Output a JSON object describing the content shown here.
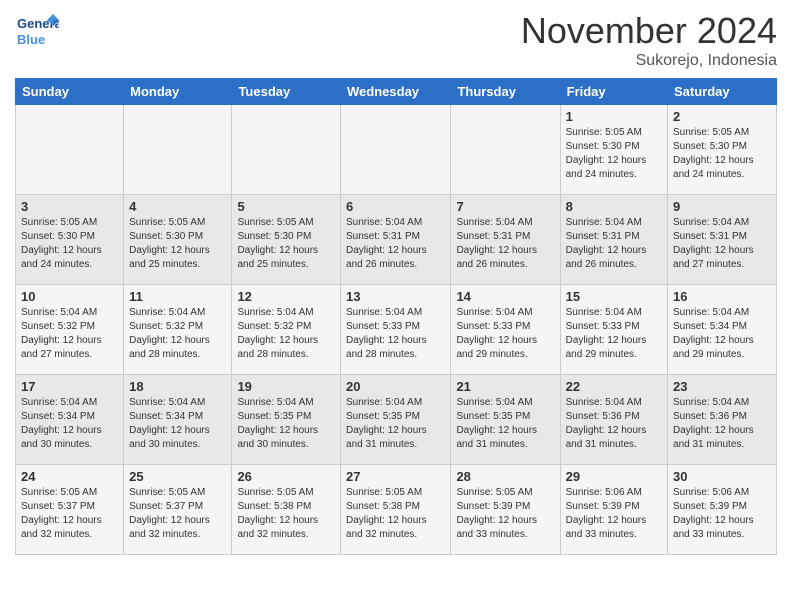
{
  "logo": {
    "general": "General",
    "blue": "Blue"
  },
  "header": {
    "month": "November 2024",
    "location": "Sukorejo, Indonesia"
  },
  "weekdays": [
    "Sunday",
    "Monday",
    "Tuesday",
    "Wednesday",
    "Thursday",
    "Friday",
    "Saturday"
  ],
  "weeks": [
    [
      {
        "day": "",
        "info": ""
      },
      {
        "day": "",
        "info": ""
      },
      {
        "day": "",
        "info": ""
      },
      {
        "day": "",
        "info": ""
      },
      {
        "day": "",
        "info": ""
      },
      {
        "day": "1",
        "info": "Sunrise: 5:05 AM\nSunset: 5:30 PM\nDaylight: 12 hours\nand 24 minutes."
      },
      {
        "day": "2",
        "info": "Sunrise: 5:05 AM\nSunset: 5:30 PM\nDaylight: 12 hours\nand 24 minutes."
      }
    ],
    [
      {
        "day": "3",
        "info": "Sunrise: 5:05 AM\nSunset: 5:30 PM\nDaylight: 12 hours\nand 24 minutes."
      },
      {
        "day": "4",
        "info": "Sunrise: 5:05 AM\nSunset: 5:30 PM\nDaylight: 12 hours\nand 25 minutes."
      },
      {
        "day": "5",
        "info": "Sunrise: 5:05 AM\nSunset: 5:30 PM\nDaylight: 12 hours\nand 25 minutes."
      },
      {
        "day": "6",
        "info": "Sunrise: 5:04 AM\nSunset: 5:31 PM\nDaylight: 12 hours\nand 26 minutes."
      },
      {
        "day": "7",
        "info": "Sunrise: 5:04 AM\nSunset: 5:31 PM\nDaylight: 12 hours\nand 26 minutes."
      },
      {
        "day": "8",
        "info": "Sunrise: 5:04 AM\nSunset: 5:31 PM\nDaylight: 12 hours\nand 26 minutes."
      },
      {
        "day": "9",
        "info": "Sunrise: 5:04 AM\nSunset: 5:31 PM\nDaylight: 12 hours\nand 27 minutes."
      }
    ],
    [
      {
        "day": "10",
        "info": "Sunrise: 5:04 AM\nSunset: 5:32 PM\nDaylight: 12 hours\nand 27 minutes."
      },
      {
        "day": "11",
        "info": "Sunrise: 5:04 AM\nSunset: 5:32 PM\nDaylight: 12 hours\nand 28 minutes."
      },
      {
        "day": "12",
        "info": "Sunrise: 5:04 AM\nSunset: 5:32 PM\nDaylight: 12 hours\nand 28 minutes."
      },
      {
        "day": "13",
        "info": "Sunrise: 5:04 AM\nSunset: 5:33 PM\nDaylight: 12 hours\nand 28 minutes."
      },
      {
        "day": "14",
        "info": "Sunrise: 5:04 AM\nSunset: 5:33 PM\nDaylight: 12 hours\nand 29 minutes."
      },
      {
        "day": "15",
        "info": "Sunrise: 5:04 AM\nSunset: 5:33 PM\nDaylight: 12 hours\nand 29 minutes."
      },
      {
        "day": "16",
        "info": "Sunrise: 5:04 AM\nSunset: 5:34 PM\nDaylight: 12 hours\nand 29 minutes."
      }
    ],
    [
      {
        "day": "17",
        "info": "Sunrise: 5:04 AM\nSunset: 5:34 PM\nDaylight: 12 hours\nand 30 minutes."
      },
      {
        "day": "18",
        "info": "Sunrise: 5:04 AM\nSunset: 5:34 PM\nDaylight: 12 hours\nand 30 minutes."
      },
      {
        "day": "19",
        "info": "Sunrise: 5:04 AM\nSunset: 5:35 PM\nDaylight: 12 hours\nand 30 minutes."
      },
      {
        "day": "20",
        "info": "Sunrise: 5:04 AM\nSunset: 5:35 PM\nDaylight: 12 hours\nand 31 minutes."
      },
      {
        "day": "21",
        "info": "Sunrise: 5:04 AM\nSunset: 5:35 PM\nDaylight: 12 hours\nand 31 minutes."
      },
      {
        "day": "22",
        "info": "Sunrise: 5:04 AM\nSunset: 5:36 PM\nDaylight: 12 hours\nand 31 minutes."
      },
      {
        "day": "23",
        "info": "Sunrise: 5:04 AM\nSunset: 5:36 PM\nDaylight: 12 hours\nand 31 minutes."
      }
    ],
    [
      {
        "day": "24",
        "info": "Sunrise: 5:05 AM\nSunset: 5:37 PM\nDaylight: 12 hours\nand 32 minutes."
      },
      {
        "day": "25",
        "info": "Sunrise: 5:05 AM\nSunset: 5:37 PM\nDaylight: 12 hours\nand 32 minutes."
      },
      {
        "day": "26",
        "info": "Sunrise: 5:05 AM\nSunset: 5:38 PM\nDaylight: 12 hours\nand 32 minutes."
      },
      {
        "day": "27",
        "info": "Sunrise: 5:05 AM\nSunset: 5:38 PM\nDaylight: 12 hours\nand 32 minutes."
      },
      {
        "day": "28",
        "info": "Sunrise: 5:05 AM\nSunset: 5:39 PM\nDaylight: 12 hours\nand 33 minutes."
      },
      {
        "day": "29",
        "info": "Sunrise: 5:06 AM\nSunset: 5:39 PM\nDaylight: 12 hours\nand 33 minutes."
      },
      {
        "day": "30",
        "info": "Sunrise: 5:06 AM\nSunset: 5:39 PM\nDaylight: 12 hours\nand 33 minutes."
      }
    ]
  ]
}
